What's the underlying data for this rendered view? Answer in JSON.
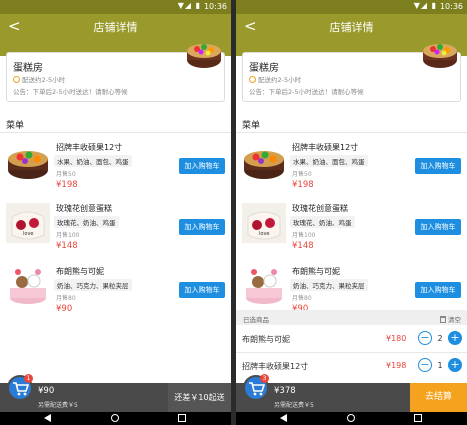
{
  "status": {
    "time": "10:36",
    "icons": "▼◢ ▮"
  },
  "header": {
    "back_glyph": "<",
    "title": "店铺详情"
  },
  "shop": {
    "name": "蛋糕房",
    "delivery": "配送约2-5小时",
    "notice": "公告：下单后2-5小时送达！请耐心等候"
  },
  "menu": {
    "section_label": "菜单",
    "add_label": "加入购物车",
    "items": [
      {
        "name": "招牌丰收硕果12寸",
        "desc": "水果、奶油、面包、鸡蛋",
        "sales": "月售50",
        "price": "¥198"
      },
      {
        "name": "玫瑰花创意蛋糕",
        "desc": "玫瑰花、奶油、鸡蛋",
        "sales": "月售100",
        "price": "¥148"
      },
      {
        "name": "布朗熊与可妮",
        "desc": "奶油、巧克力、果粒夹层",
        "sales": "月售80",
        "price": "¥90"
      }
    ]
  },
  "screen1_cart": {
    "badge": "1",
    "total": "¥90",
    "fee": "另需配送费￥5",
    "min_label": "还差￥10起送"
  },
  "screen2_cart": {
    "badge": "3",
    "total": "¥378",
    "fee": "另需配送费￥5",
    "checkout_label": "去结算",
    "panel_title": "已选商品",
    "clear_label": "清空",
    "items": [
      {
        "name": "布朗熊与可妮",
        "price": "¥180",
        "qty": "2"
      },
      {
        "name": "招牌丰收硕果12寸",
        "price": "¥198",
        "qty": "1"
      }
    ],
    "minus_glyph": "−",
    "plus_glyph": "+"
  },
  "colors": {
    "olive": "#9a9a2c",
    "accent_blue": "#1e8fe0",
    "price_red": "#e8463c",
    "checkout_orange": "#f5a21e"
  },
  "icons": [
    "back-arrow-icon",
    "clock-icon",
    "cart-icon",
    "trash-icon",
    "nav-back-icon",
    "nav-home-icon",
    "nav-recent-icon"
  ]
}
